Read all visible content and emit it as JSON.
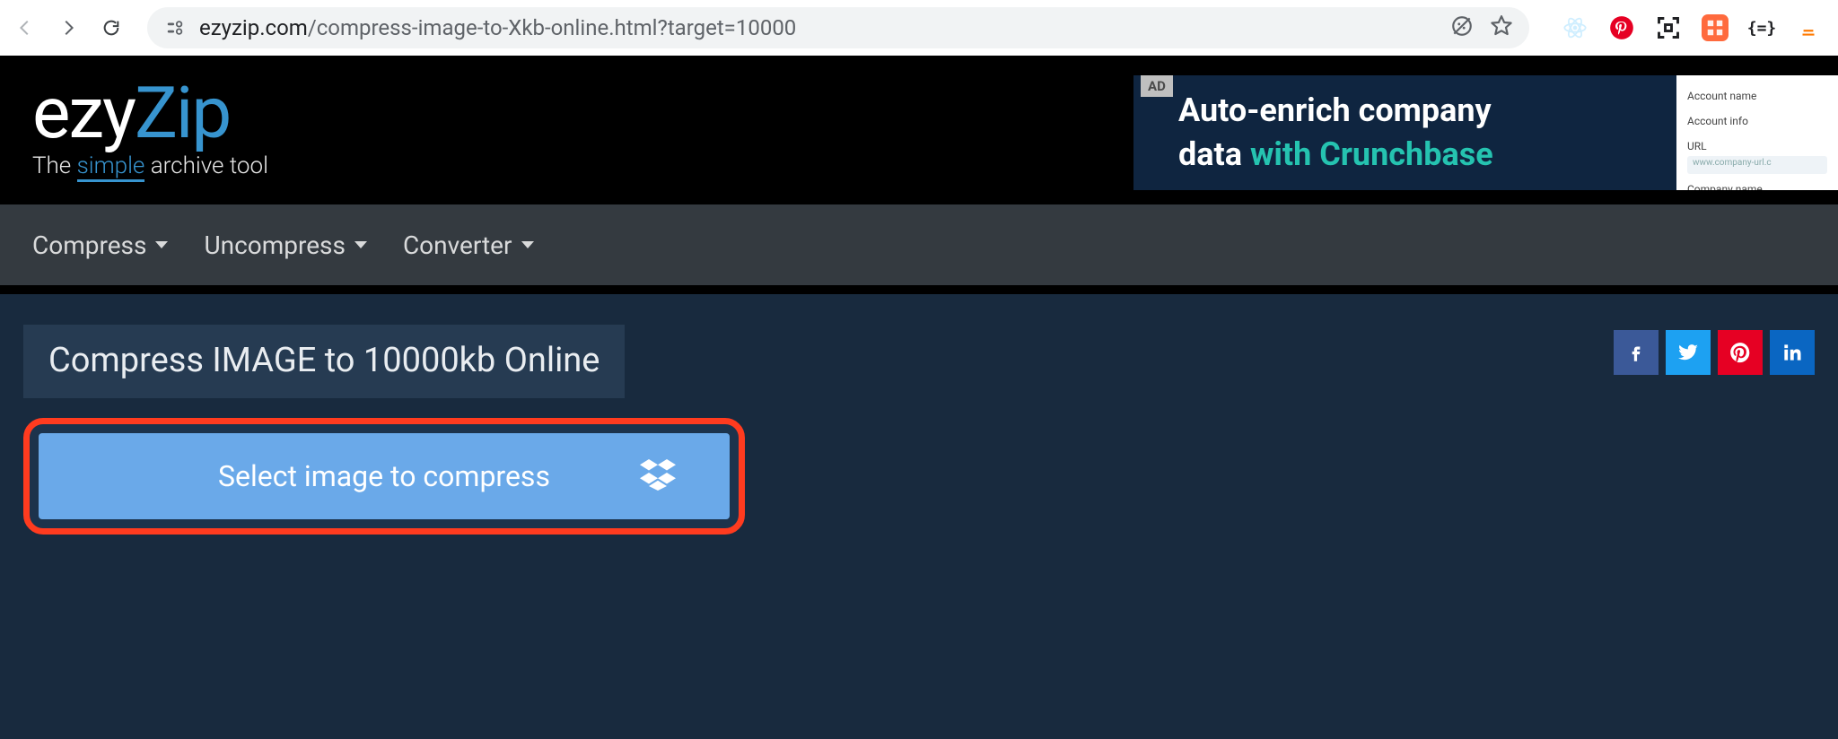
{
  "browser": {
    "url_host": "ezyzip.com",
    "url_path": "/compress-image-to-Xkb-online.html?target=10000"
  },
  "logo": {
    "part1": "ezy",
    "part2": "Zip"
  },
  "tagline": {
    "pre": "The ",
    "mid": "simple",
    "post": " archive tool"
  },
  "ad": {
    "badge": "AD",
    "line1": "Auto-enrich company",
    "line2a": "data ",
    "line2b": "with Crunchbase",
    "form": {
      "label_account_name": "Account name",
      "label_account_info": "Account info",
      "label_url": "URL",
      "url_placeholder": "www.company-url.c",
      "label_company_name": "Company name"
    }
  },
  "nav": {
    "compress": "Compress",
    "uncompress": "Uncompress",
    "converter": "Converter"
  },
  "page": {
    "title": "Compress IMAGE to 10000kb Online",
    "select_label": "Select image to compress"
  }
}
